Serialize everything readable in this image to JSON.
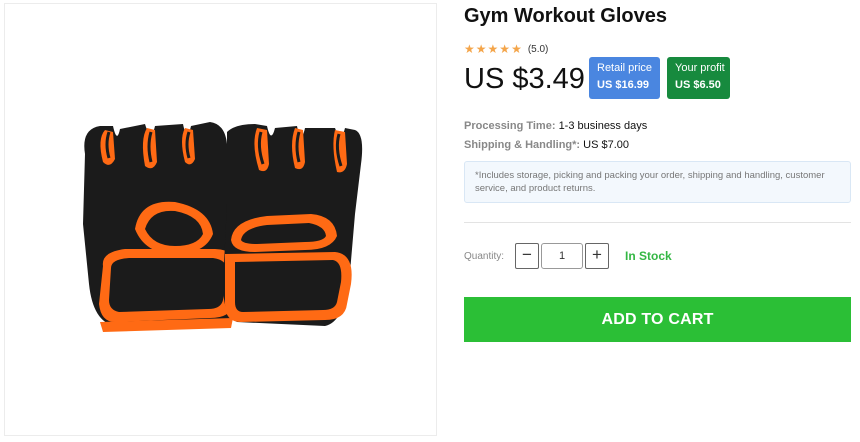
{
  "product": {
    "title": "Gym Workout Gloves",
    "rating": {
      "stars": 5,
      "value_text": "(5.0)"
    },
    "price": "US $3.49",
    "image_icon": "fingerless-gym-gloves-image"
  },
  "badges": {
    "retail": {
      "label": "Retail price",
      "value": "US $16.99",
      "color": "#4a86e0"
    },
    "profit": {
      "label": "Your profit",
      "value": "US $6.50",
      "color": "#178a3e"
    }
  },
  "details": {
    "processing_label": "Processing Time:",
    "processing_value": "1-3 business days",
    "shipping_label": "Shipping & Handling*:",
    "shipping_value": "US $7.00",
    "note": "*Includes storage, picking and packing your order, shipping and handling, customer service, and product returns."
  },
  "quantity": {
    "label": "Quantity:",
    "minus": "−",
    "plus": "+",
    "value": "1",
    "stock": "In Stock"
  },
  "cart": {
    "label": "ADD TO CART",
    "color": "#2bbf36"
  }
}
